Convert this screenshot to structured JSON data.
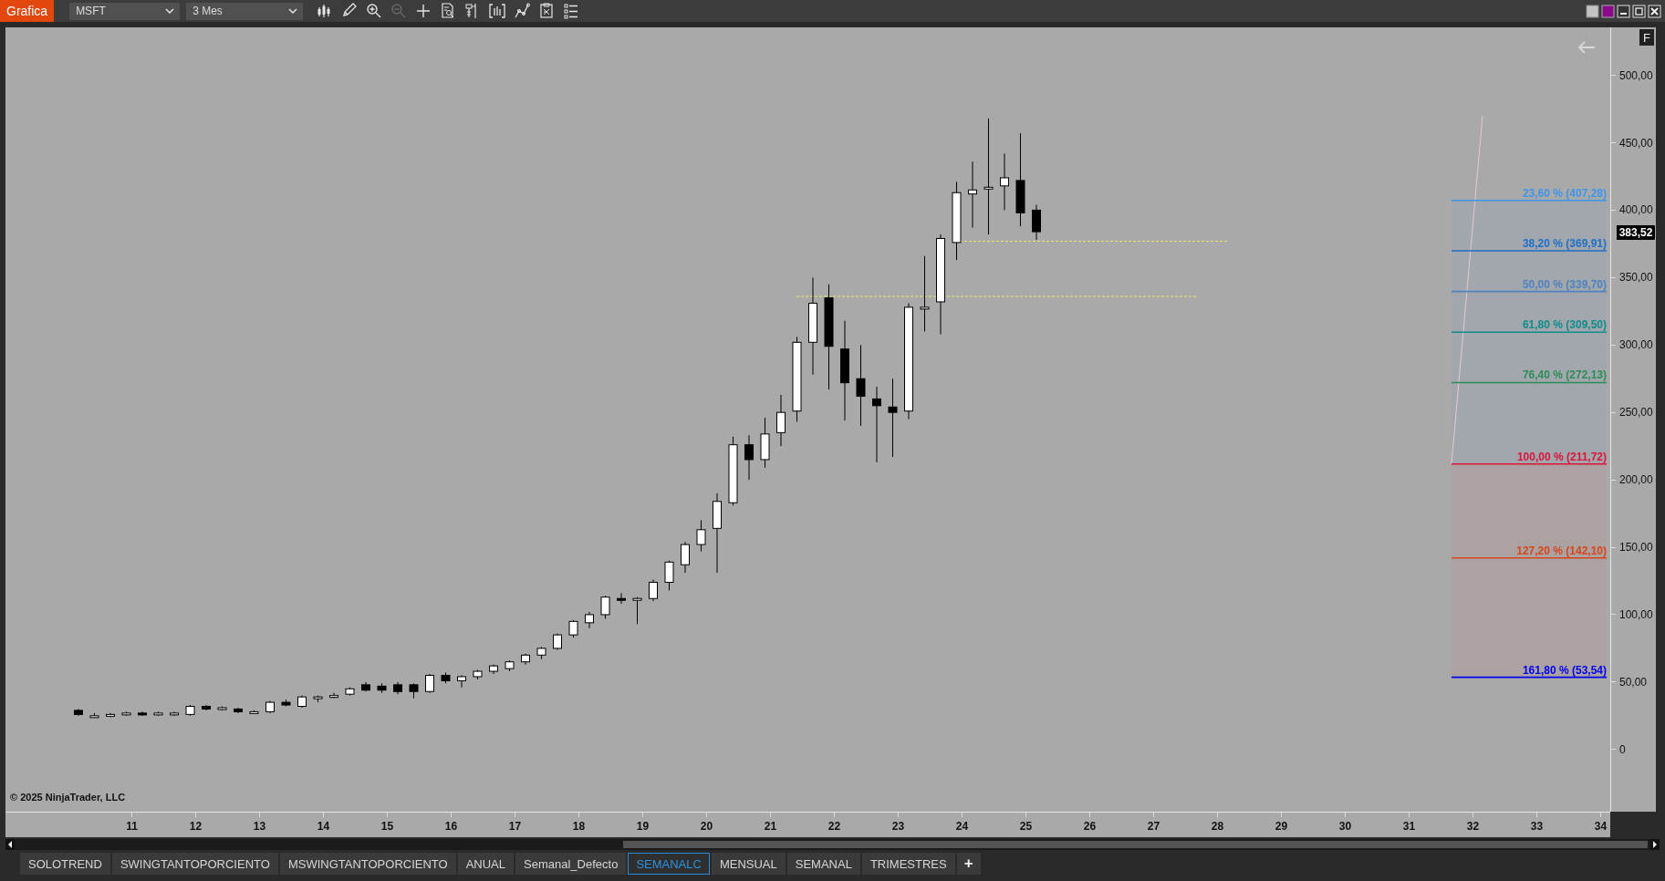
{
  "toolbar": {
    "app_button": "Grafica",
    "instrument": "MSFT",
    "period": "3 Mes",
    "tools": [
      {
        "kind": "bars",
        "disabled": false
      },
      {
        "kind": "pencil",
        "disabled": false
      },
      {
        "kind": "zoom-in",
        "disabled": false
      },
      {
        "kind": "zoom-out",
        "disabled": true
      },
      {
        "kind": "crosshair",
        "disabled": false
      },
      {
        "kind": "properties",
        "disabled": false
      },
      {
        "kind": "data-box",
        "disabled": false
      },
      {
        "kind": "brackets",
        "disabled": false
      },
      {
        "kind": "line",
        "disabled": false
      },
      {
        "kind": "strategy",
        "disabled": false
      },
      {
        "kind": "list",
        "disabled": false
      }
    ]
  },
  "window_controls": [
    {
      "kind": "grey"
    },
    {
      "kind": "purple"
    },
    {
      "kind": "minimize"
    },
    {
      "kind": "maximize"
    },
    {
      "kind": "close"
    }
  ],
  "chart": {
    "flag": "F",
    "copyright": "© 2025 NinjaTrader, LLC",
    "price_marker": "383,52",
    "price_axis": [
      "500,00",
      "450,00",
      "400,00",
      "350,00",
      "300,00",
      "250,00",
      "200,00",
      "150,00",
      "100,00",
      "50,00",
      "0"
    ],
    "time_axis": [
      "11",
      "12",
      "13",
      "14",
      "15",
      "16",
      "17",
      "18",
      "19",
      "20",
      "21",
      "22",
      "23",
      "24",
      "25",
      "26",
      "27",
      "28",
      "29",
      "30",
      "31",
      "32",
      "33",
      "34"
    ],
    "fib_levels": [
      {
        "label": "23,60 % (407,28)",
        "color": "#3f95ea"
      },
      {
        "label": "38,20 % (369,91)",
        "color": "#1f6fc8"
      },
      {
        "label": "50,00 % (339,70)",
        "color": "#4f82bf"
      },
      {
        "label": "61,80 % (309,50)",
        "color": "#0f8c8c"
      },
      {
        "label": "76,40 % (272,13)",
        "color": "#2e8b57"
      },
      {
        "label": "100,00 % (211,72)",
        "color": "#dc143c"
      },
      {
        "label": "127,20 % (142,10)",
        "color": "#d8441c"
      },
      {
        "label": "161,80 % (53,54)",
        "color": "#0000ee"
      }
    ]
  },
  "tabs": [
    {
      "label": "SOLOTREND",
      "selected": false
    },
    {
      "label": "SWINGTANTOPORCIENTO",
      "selected": false
    },
    {
      "label": "MSWINGTANTOPORCIENTO",
      "selected": false
    },
    {
      "label": "ANUAL",
      "selected": false
    },
    {
      "label": "Semanal_Defecto",
      "selected": false
    },
    {
      "label": "SEMANALC",
      "selected": true
    },
    {
      "label": "MENSUAL",
      "selected": false
    },
    {
      "label": "SEMANAL",
      "selected": false
    },
    {
      "label": "TRIMESTRES",
      "selected": false
    }
  ],
  "add_tab": "+"
}
